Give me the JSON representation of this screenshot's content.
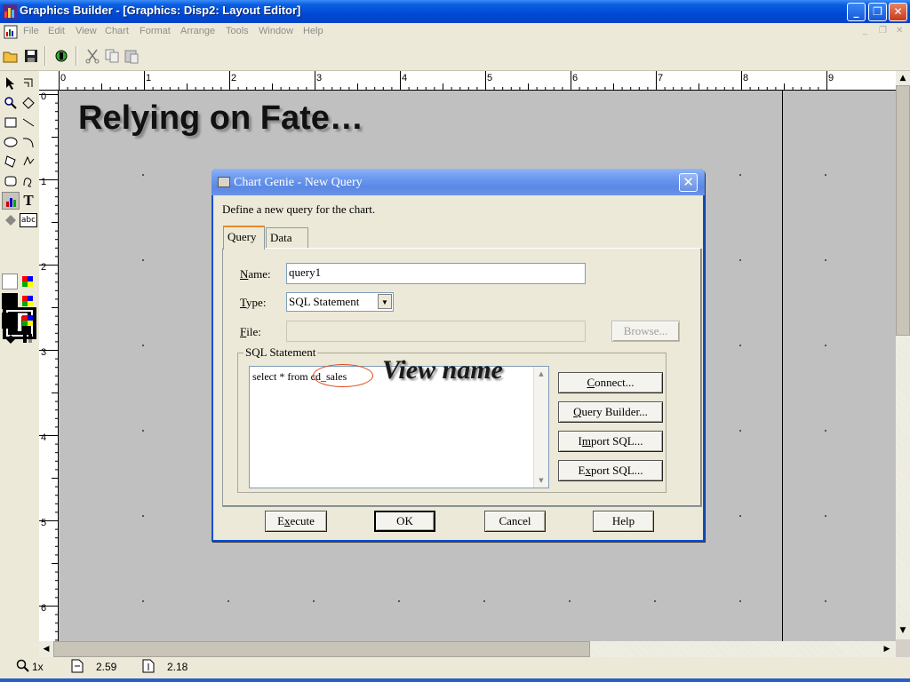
{
  "window": {
    "title": "Graphics Builder - [Graphics: Disp2: Layout Editor]",
    "controls": {
      "minimize": "_",
      "restore": "❐",
      "close": "✕"
    }
  },
  "menubar": {
    "items": [
      "File",
      "Edit",
      "View",
      "Chart",
      "Format",
      "Arrange",
      "Tools",
      "Window",
      "Help"
    ],
    "mdi_controls": [
      "_",
      "❐",
      "✕"
    ]
  },
  "toolbar": {
    "icons": [
      "open-folder-icon",
      "save-disk-icon",
      "run-icon",
      "cut-icon",
      "copy-icon",
      "paste-icon"
    ]
  },
  "tool_palette": {
    "text_tool_label": "T",
    "text_field_label": "abc",
    "big_text_label": "T"
  },
  "rulers": {
    "horizontal": [
      "0",
      "1",
      "2",
      "3",
      "4",
      "5",
      "6",
      "7",
      "8",
      "9"
    ],
    "vertical": [
      "0",
      "1",
      "2",
      "3",
      "4",
      "5",
      "6"
    ]
  },
  "canvas": {
    "heading": "Relying on Fate…"
  },
  "statusbar": {
    "zoom": "1x",
    "x_pos": "2.59",
    "y_pos": "2.18"
  },
  "dialog": {
    "title": "Chart Genie - New Query",
    "close": "✕",
    "description": "Define a new query for the chart.",
    "tabs": [
      "Query",
      "Data"
    ],
    "name_label_prefix": "N",
    "name_label_rest": "ame:",
    "name_value": "query1",
    "type_label_prefix": "T",
    "type_label_rest": "ype:",
    "type_value": "SQL Statement",
    "file_label_prefix": "F",
    "file_label_rest": "ile:",
    "file_value": "",
    "browse": "Browse...",
    "sql_group": "SQL Statement",
    "sql_text": "select * from cd_sales",
    "annotation": "View name",
    "buttons": {
      "connect_u": "C",
      "connect_rest": "onnect...",
      "query_builder_u": "Q",
      "query_builder_rest": "uery Builder...",
      "import_pre": "I",
      "import_u": "m",
      "import_rest": "port SQL...",
      "export_pre": "E",
      "export_u": "x",
      "export_rest": "port SQL...",
      "execute_pre": "E",
      "execute_u": "x",
      "execute_rest": "ecute",
      "ok": "OK",
      "cancel": "Cancel",
      "help": "Help"
    }
  },
  "colors": {
    "titlebar": "#0a5fe0",
    "annotation_oval": "#e04a1a",
    "canvas": "#c0c0c0"
  }
}
